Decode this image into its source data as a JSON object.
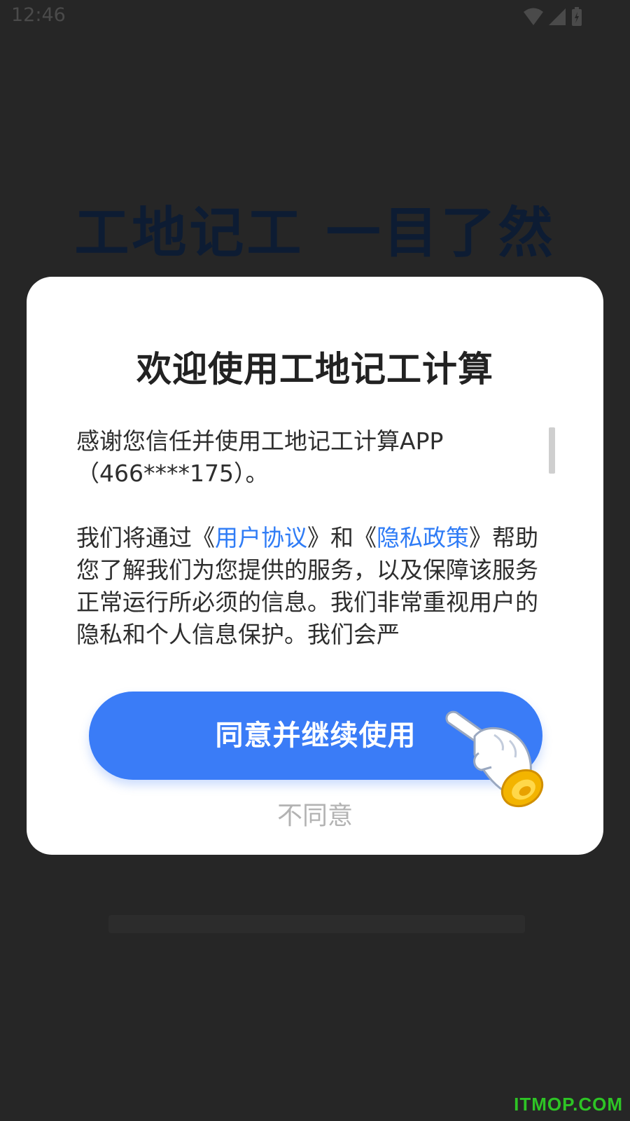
{
  "status_bar": {
    "time": "12:46",
    "icons": [
      "wifi-icon",
      "signal-icon",
      "battery-icon"
    ]
  },
  "background": {
    "hero_title": "工地记工 一目了然"
  },
  "dialog": {
    "title": "欢迎使用工地记工计算",
    "intro": "感谢您信任并使用工地记工计算APP（466****175）。",
    "body_prefix": "我们将通过《",
    "user_agreement": "用户协议",
    "body_mid": "》和《",
    "privacy_policy": "隐私政策",
    "body_suffix": "》帮助您了解我们为您提供的服务，以及保障该服务正常运行所必须的信息。我们非常重视用户的隐私和个人信息保护。我们会严",
    "agree_button": "同意并继续使用",
    "disagree_link": "不同意"
  },
  "colors": {
    "accent": "#3a7cf7",
    "link": "#2f7cf6",
    "watermark": "#2ec425"
  },
  "watermark": "ITMOP.COM"
}
